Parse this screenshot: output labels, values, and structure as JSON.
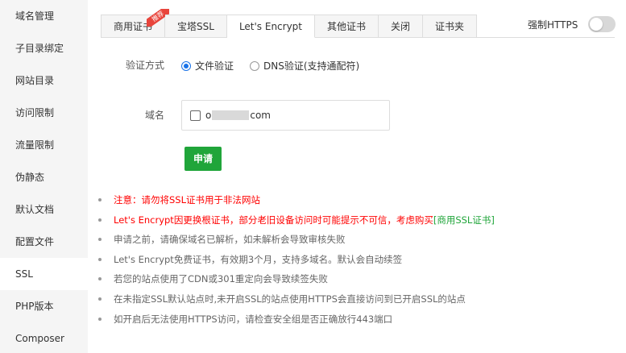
{
  "sidebar": {
    "items": [
      {
        "label": "域名管理"
      },
      {
        "label": "子目录绑定"
      },
      {
        "label": "网站目录"
      },
      {
        "label": "访问限制"
      },
      {
        "label": "流量限制"
      },
      {
        "label": "伪静态"
      },
      {
        "label": "默认文档"
      },
      {
        "label": "配置文件"
      },
      {
        "label": "SSL"
      },
      {
        "label": "PHP版本"
      },
      {
        "label": "Composer"
      }
    ],
    "active_index": 8
  },
  "tabs": [
    {
      "label": "商用证书",
      "badge": "推荐"
    },
    {
      "label": "宝塔SSL"
    },
    {
      "label": "Let's Encrypt"
    },
    {
      "label": "其他证书"
    },
    {
      "label": "关闭"
    },
    {
      "label": "证书夹"
    }
  ],
  "active_tab": 2,
  "force_https": {
    "label": "强制HTTPS",
    "enabled": false
  },
  "form": {
    "verify_label": "验证方式",
    "verify_options": [
      {
        "label": "文件验证",
        "checked": true
      },
      {
        "label": "DNS验证(支持通配符)",
        "checked": false
      }
    ],
    "domain_label": "域名",
    "domain_prefix": "o",
    "domain_suffix": "com",
    "domain_checked": false,
    "apply_label": "申请"
  },
  "notes": [
    {
      "text": "注意：请勿将SSL证书用于非法网站",
      "color": "red"
    },
    {
      "text": "Let's Encrypt因更换根证书，部分老旧设备访问时可能提示不可信，考虑购买",
      "link": "[商用SSL证书]",
      "color": "red"
    },
    {
      "text": "申请之前，请确保域名已解析，如未解析会导致审核失败",
      "color": "gray"
    },
    {
      "text": "Let's Encrypt免费证书，有效期3个月，支持多域名。默认会自动续签",
      "color": "gray"
    },
    {
      "text": "若您的站点使用了CDN或301重定向会导致续签失败",
      "color": "gray"
    },
    {
      "text": "在未指定SSL默认站点时,未开启SSL的站点使用HTTPS会直接访问到已开启SSL的站点",
      "color": "gray"
    },
    {
      "text": "如开启后无法使用HTTPS访问，请检查安全组是否正确放行443端口",
      "color": "gray"
    }
  ],
  "colors": {
    "accent_green": "#20a53a",
    "warning_red": "#ff0000",
    "radio_blue": "#1a73e8",
    "badge_red": "#e8453c"
  }
}
